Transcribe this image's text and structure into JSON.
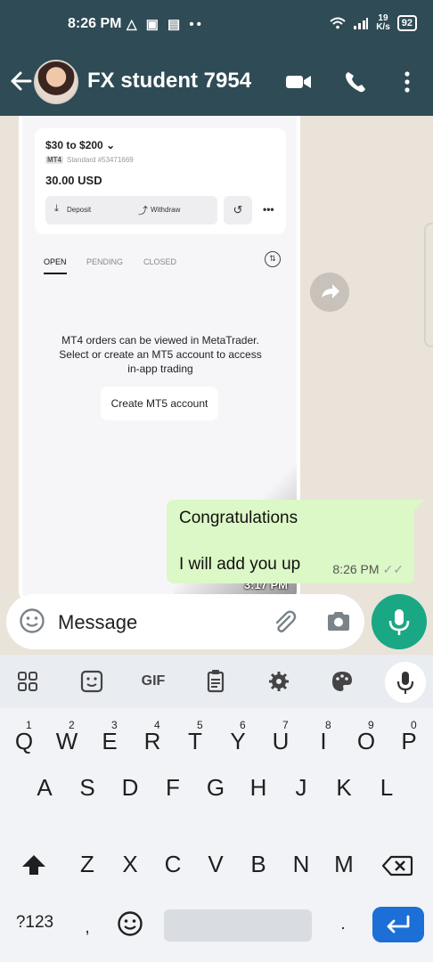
{
  "status_bar": {
    "time": "8:26 PM",
    "notif_icons": "△ ▣ ▤ ••",
    "net_speed_top": "19",
    "net_speed_unit": "K/s",
    "battery": "92"
  },
  "header": {
    "contact_name": "FX student 7954"
  },
  "shared_screenshot": {
    "balance_range": "$30 to $200",
    "platform_badge": "MT4",
    "account_type": "Standard #53471669",
    "balance": "30.00 USD",
    "deposit_label": "Deposit",
    "withdraw_label": "Withdraw",
    "more_label": "•••",
    "tabs": [
      "OPEN",
      "PENDING",
      "CLOSED"
    ],
    "info_line1": "MT4 orders can be viewed in MetaTrader.",
    "info_line2": "Select or create an MT5 account to access",
    "info_line3": "in-app trading",
    "create_button": "Create MT5 account",
    "timestamp": "3:17 PM"
  },
  "message": {
    "line1": "Congratulations",
    "line2": "I will add you up",
    "time": "8:26 PM",
    "ticks": "✓✓"
  },
  "composer": {
    "placeholder": "Message"
  },
  "keyboard": {
    "toolbar": [
      "apps-grid",
      "sticker",
      "GIF",
      "clipboard",
      "settings",
      "theme-palette",
      "voice-input"
    ],
    "gif_label": "GIF",
    "row1": [
      {
        "key": "Q",
        "sup": "1"
      },
      {
        "key": "W",
        "sup": "2"
      },
      {
        "key": "E",
        "sup": "3"
      },
      {
        "key": "R",
        "sup": "4"
      },
      {
        "key": "T",
        "sup": "5"
      },
      {
        "key": "Y",
        "sup": "6"
      },
      {
        "key": "U",
        "sup": "7"
      },
      {
        "key": "I",
        "sup": "8"
      },
      {
        "key": "O",
        "sup": "9"
      },
      {
        "key": "P",
        "sup": "0"
      }
    ],
    "row2": [
      "A",
      "S",
      "D",
      "F",
      "G",
      "H",
      "J",
      "K",
      "L"
    ],
    "row3": [
      "Z",
      "X",
      "C",
      "V",
      "B",
      "N",
      "M"
    ],
    "symbols_key": "?123",
    "comma_key": ",",
    "period_key": "."
  }
}
